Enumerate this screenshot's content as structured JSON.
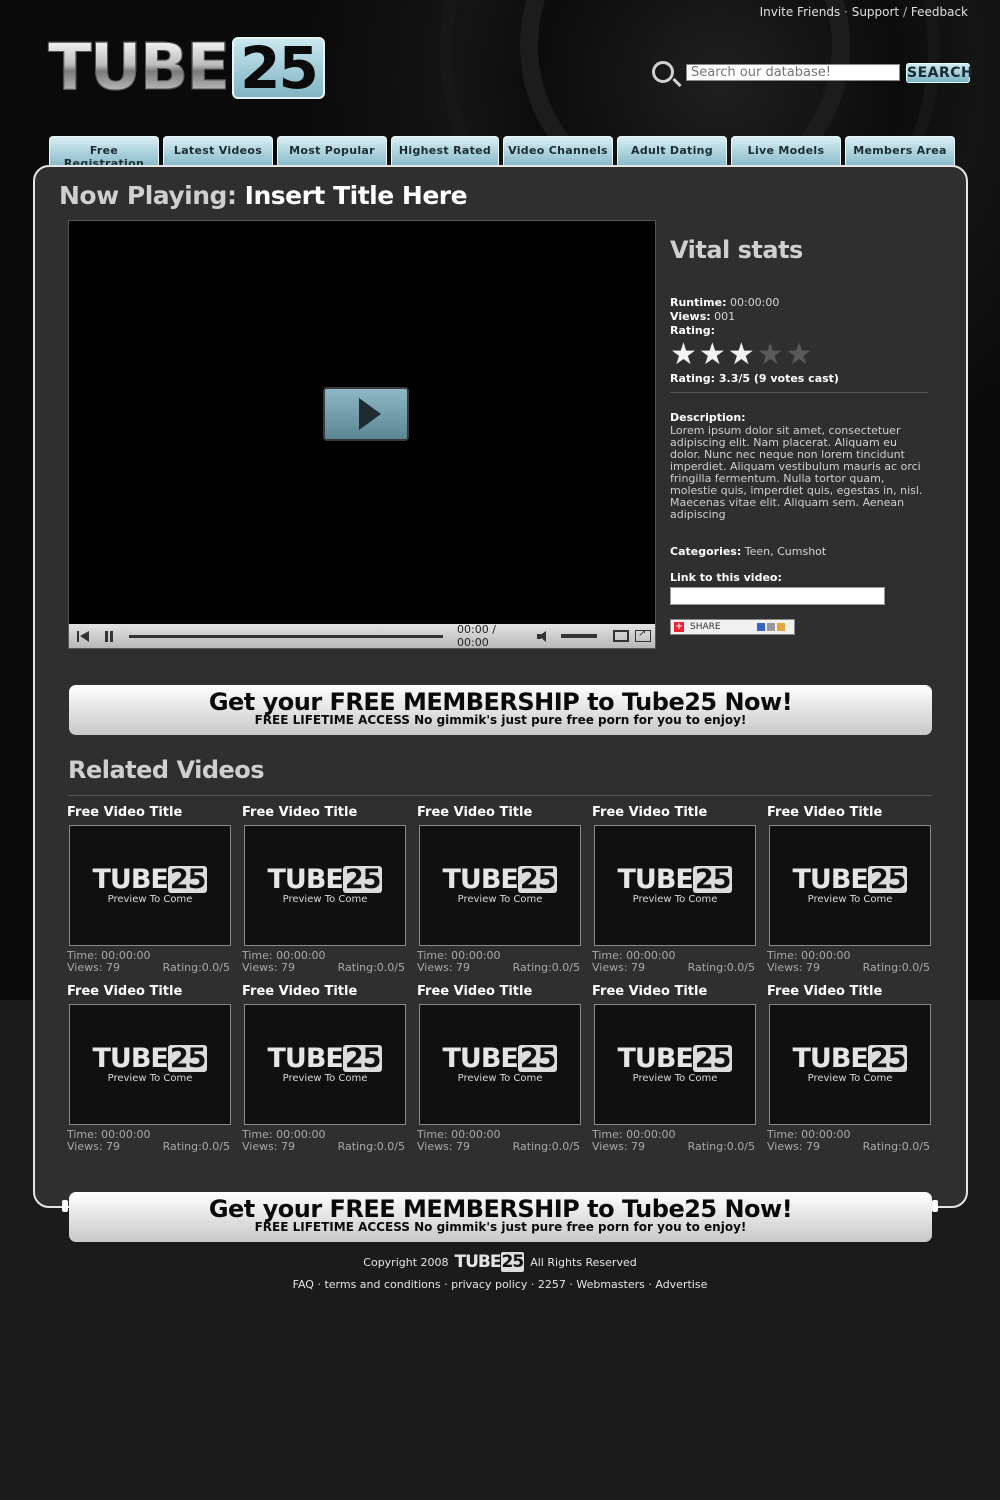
{
  "top_links": {
    "invite": "Invite Friends",
    "support": "Support",
    "feedback": "Feedback",
    "sep1": "·",
    "sep2": "/"
  },
  "logo": {
    "text": "TUBE",
    "number": "25"
  },
  "search": {
    "placeholder": "Search our database!",
    "button": "SEARCH"
  },
  "nav": [
    {
      "label": "Free Registration"
    },
    {
      "label": "Latest Videos"
    },
    {
      "label": "Most Popular"
    },
    {
      "label": "Highest Rated"
    },
    {
      "label": "Video Channels"
    },
    {
      "label": "Adult Dating"
    },
    {
      "label": "Live Models"
    },
    {
      "label": "Members Area"
    }
  ],
  "now_playing": {
    "prefix": "Now Playing:",
    "title": "Insert Title Here"
  },
  "player": {
    "time": "00:00 / 00:00"
  },
  "stats": {
    "heading": "Vital stats",
    "runtime_label": "Runtime:",
    "runtime": "00:00:00",
    "views_label": "Views:",
    "views": "001",
    "rating_label": "Rating:",
    "rating_value": 3,
    "rating_max": 5,
    "rating_text": "Rating: 3.3/5 (9 votes cast)",
    "description_label": "Description:",
    "description": "Lorem ipsum dolor sit amet, consectetuer adipiscing elit. Nam placerat. Aliquam eu dolor. Nunc nec neque non lorem tincidunt imperdiet. Aliquam vestibulum mauris ac orci fringilla fermentum. Nulla tortor quam, molestie quis, imperdiet quis, egestas in, nisl. Maecenas vitae elit. Aliquam sem. Aenean adipiscing",
    "categories_label": "Categories:",
    "categories": "Teen, Cumshot",
    "link_label": "Link to this video:",
    "share": "SHARE"
  },
  "banner": {
    "headline": "Get your FREE MEMBERSHIP to Tube25 Now!",
    "sub": "FREE LIFETIME ACCESS No gimmik's just pure free porn for you to enjoy!"
  },
  "related": {
    "heading": "Related Videos",
    "items": [
      {
        "title": "Free Video Title",
        "preview": "Preview To Come",
        "time": "Time: 00:00:00",
        "views": "Views: 79",
        "rating": "Rating:0.0/5"
      },
      {
        "title": "Free Video Title",
        "preview": "Preview To Come",
        "time": "Time: 00:00:00",
        "views": "Views: 79",
        "rating": "Rating:0.0/5"
      },
      {
        "title": "Free Video Title",
        "preview": "Preview To Come",
        "time": "Time: 00:00:00",
        "views": "Views: 79",
        "rating": "Rating:0.0/5"
      },
      {
        "title": "Free Video Title",
        "preview": "Preview To Come",
        "time": "Time: 00:00:00",
        "views": "Views: 79",
        "rating": "Rating:0.0/5"
      },
      {
        "title": "Free Video Title",
        "preview": "Preview To Come",
        "time": "Time: 00:00:00",
        "views": "Views: 79",
        "rating": "Rating:0.0/5"
      },
      {
        "title": "Free Video Title",
        "preview": "Preview To Come",
        "time": "Time: 00:00:00",
        "views": "Views: 79",
        "rating": "Rating:0.0/5"
      },
      {
        "title": "Free Video Title",
        "preview": "Preview To Come",
        "time": "Time: 00:00:00",
        "views": "Views: 79",
        "rating": "Rating:0.0/5"
      },
      {
        "title": "Free Video Title",
        "preview": "Preview To Come",
        "time": "Time: 00:00:00",
        "views": "Views: 79",
        "rating": "Rating:0.0/5"
      },
      {
        "title": "Free Video Title",
        "preview": "Preview To Come",
        "time": "Time: 00:00:00",
        "views": "Views: 79",
        "rating": "Rating:0.0/5"
      },
      {
        "title": "Free Video Title",
        "preview": "Preview To Come",
        "time": "Time: 00:00:00",
        "views": "Views: 79",
        "rating": "Rating:0.0/5"
      }
    ]
  },
  "footer": {
    "copyright": "Copyright 2008",
    "rights": "All Rights Reserved",
    "links": [
      "FAQ",
      "terms and conditions",
      "privacy policy",
      "2257",
      "Webmasters",
      "Advertise"
    ]
  },
  "colors": {
    "accent": "#86bac8",
    "panel": "#2f2f2f",
    "background": "#1b1b1b"
  }
}
